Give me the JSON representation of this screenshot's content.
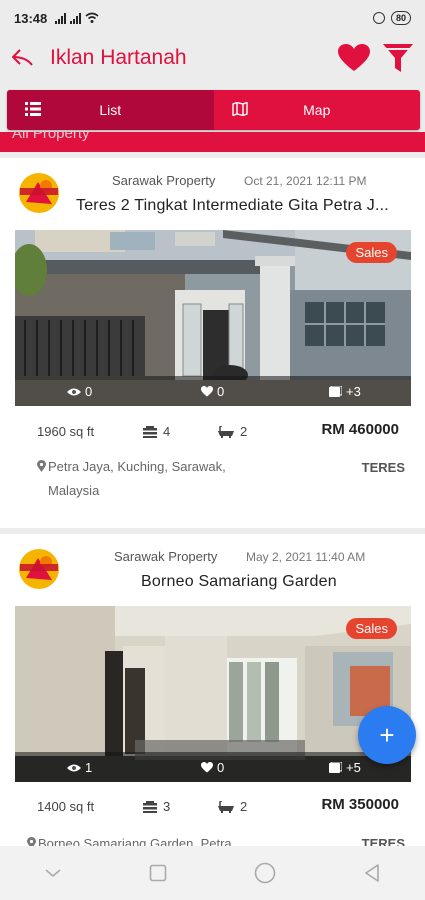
{
  "status_bar": {
    "time": "13:48",
    "battery": "80"
  },
  "app_bar": {
    "title": "Iklan Hartanah",
    "back_icon": "back-arrow-icon",
    "favorite_icon": "heart-icon",
    "filter_icon": "filter-funnel-icon",
    "accent_color": "#e0103f"
  },
  "tabs": [
    {
      "label": "List",
      "icon": "list-icon",
      "active": true
    },
    {
      "label": "Map",
      "icon": "map-icon",
      "active": false
    }
  ],
  "category": "All Property",
  "listings": [
    {
      "agent": "Sarawak Property",
      "date": "Oct 21, 2021 12:11 PM",
      "title": "Teres 2 Tingkat Intermediate Gita Petra J...",
      "badge": "Sales",
      "views": "0",
      "likes": "0",
      "photos": "+3",
      "area": "1960 sq ft",
      "beds": "4",
      "baths": "2",
      "price": "RM 460000",
      "location": "Petra Jaya, Kuching, Sarawak, Malaysia",
      "type": "TERES"
    },
    {
      "agent": "Sarawak Property",
      "date": "May 2, 2021 11:40 AM",
      "title": "Borneo Samariang Garden",
      "badge": "Sales",
      "views": "1",
      "likes": "0",
      "photos": "+5",
      "area": "1400 sq ft",
      "beds": "3",
      "baths": "2",
      "price": "RM 350000",
      "location": "Borneo Samariang Garden, Petra",
      "type": "TERES"
    }
  ],
  "fab": {
    "label": "+"
  }
}
